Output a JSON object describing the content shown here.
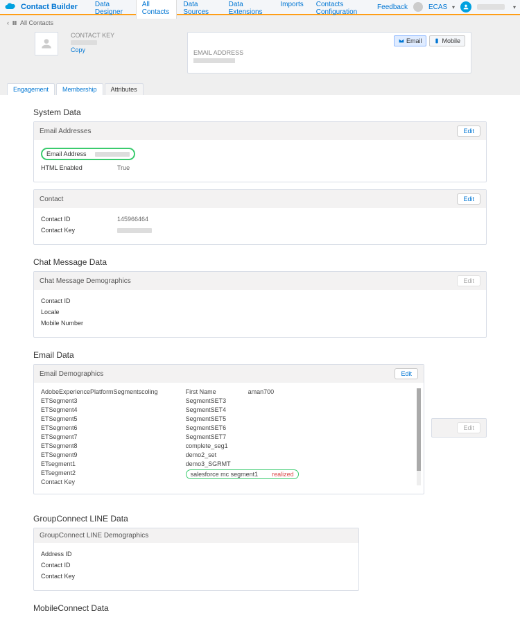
{
  "app": {
    "title": "Contact Builder",
    "tabs": [
      "Data Designer",
      "All Contacts",
      "Data Sources",
      "Data Extensions",
      "Imports",
      "Contacts Configuration"
    ],
    "active_tab": 1,
    "feedback": "Feedback",
    "org": "ECAS"
  },
  "breadcrumb": {
    "back": "‹",
    "icon": "book",
    "label": "All Contacts"
  },
  "contact_header": {
    "contact_key_label": "CONTACT KEY",
    "copy_label": "Copy",
    "email_address_label": "EMAIL ADDRESS",
    "channel_email": "Email",
    "channel_mobile": "Mobile"
  },
  "subtabs": {
    "items": [
      "Engagement",
      "Membership",
      "Attributes"
    ],
    "active": 2
  },
  "sections": {
    "system_data": {
      "title": "System Data",
      "email_addresses": {
        "heading": "Email Addresses",
        "edit": "Edit",
        "email_lbl": "Email Address",
        "html_enabled_lbl": "HTML Enabled",
        "html_enabled_val": "True"
      },
      "contact": {
        "heading": "Contact",
        "edit": "Edit",
        "id_lbl": "Contact ID",
        "id_val": "145966464",
        "key_lbl": "Contact Key"
      }
    },
    "chat": {
      "title": "Chat Message Data",
      "demo": {
        "heading": "Chat Message Demographics",
        "edit": "Edit",
        "id_lbl": "Contact ID",
        "locale_lbl": "Locale",
        "mobile_lbl": "Mobile Number"
      }
    },
    "email": {
      "title": "Email Data",
      "demo": {
        "heading": "Email Demographics",
        "edit": "Edit",
        "left": [
          "AdobeExperiencePlatformSegmentscoling",
          "ETSegment3",
          "ETSegment4",
          "ETSegment5",
          "ETSegment6",
          "ETSegment7",
          "ETSegment8",
          "ETSegment9",
          "ETsegment1",
          "ETsegment2",
          "Contact Key"
        ],
        "right": [
          {
            "lbl": "First Name",
            "val": "aman700"
          },
          {
            "lbl": "SegmentSET3",
            "val": ""
          },
          {
            "lbl": "SegmentSET4",
            "val": ""
          },
          {
            "lbl": "SegmentSET5",
            "val": ""
          },
          {
            "lbl": "SegmentSET6",
            "val": ""
          },
          {
            "lbl": "SegmentSET7",
            "val": ""
          },
          {
            "lbl": "complete_seg1",
            "val": ""
          },
          {
            "lbl": "demo2_set",
            "val": ""
          },
          {
            "lbl": "demo3_SGRMT",
            "val": ""
          },
          {
            "lbl": "salesforce mc segment1",
            "val": "realized"
          }
        ]
      },
      "extra_edit": "Edit"
    },
    "groupconnect": {
      "title": "GroupConnect LINE Data",
      "demo": {
        "heading": "GroupConnect LINE Demographics",
        "addr_lbl": "Address ID",
        "cid_lbl": "Contact ID",
        "ckey_lbl": "Contact Key"
      }
    },
    "mobile": {
      "title": "MobileConnect Data"
    }
  }
}
